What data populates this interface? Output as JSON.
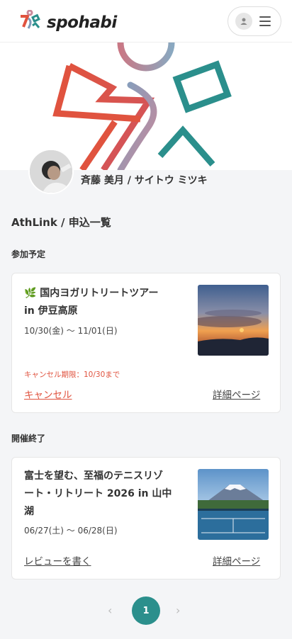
{
  "header": {
    "logo_text": "spohabi",
    "logo_icon": "spohabi-mark-icon",
    "user_icon": "user-icon",
    "menu_icon": "hamburger-menu-icon"
  },
  "profile": {
    "name": "斉藤 美月 / サイトウ ミツキ"
  },
  "page": {
    "title": "AthLink / 申込一覧"
  },
  "sections": {
    "upcoming_title": "参加予定",
    "finished_title": "開催終了"
  },
  "upcoming_card": {
    "icon": "leaf-icon",
    "title_line1": "🌿 国内ヨガリトリートツアー",
    "title_line2": "in 伊豆高原",
    "date": "10/30(金) 〜 11/01(日)",
    "cancel_deadline": "キャンセル期限：10/30まで",
    "cancel_label": "キャンセル",
    "detail_label": "詳細ページ"
  },
  "finished_card": {
    "title_line1": "富士を望む、至福のテニスリゾ",
    "title_line2": "ート・リトリート 2026 in 山中",
    "title_line3": "湖",
    "date": "06/27(土) 〜 06/28(日)",
    "review_label": "レビューを書く",
    "detail_label": "詳細ページ"
  },
  "pagination": {
    "current": "1",
    "prev_icon": "chevron-left-icon",
    "next_icon": "chevron-right-icon"
  },
  "colors": {
    "brand_teal": "#2b8f8c",
    "brand_red": "#e0533f",
    "background": "#f4f5f7"
  }
}
